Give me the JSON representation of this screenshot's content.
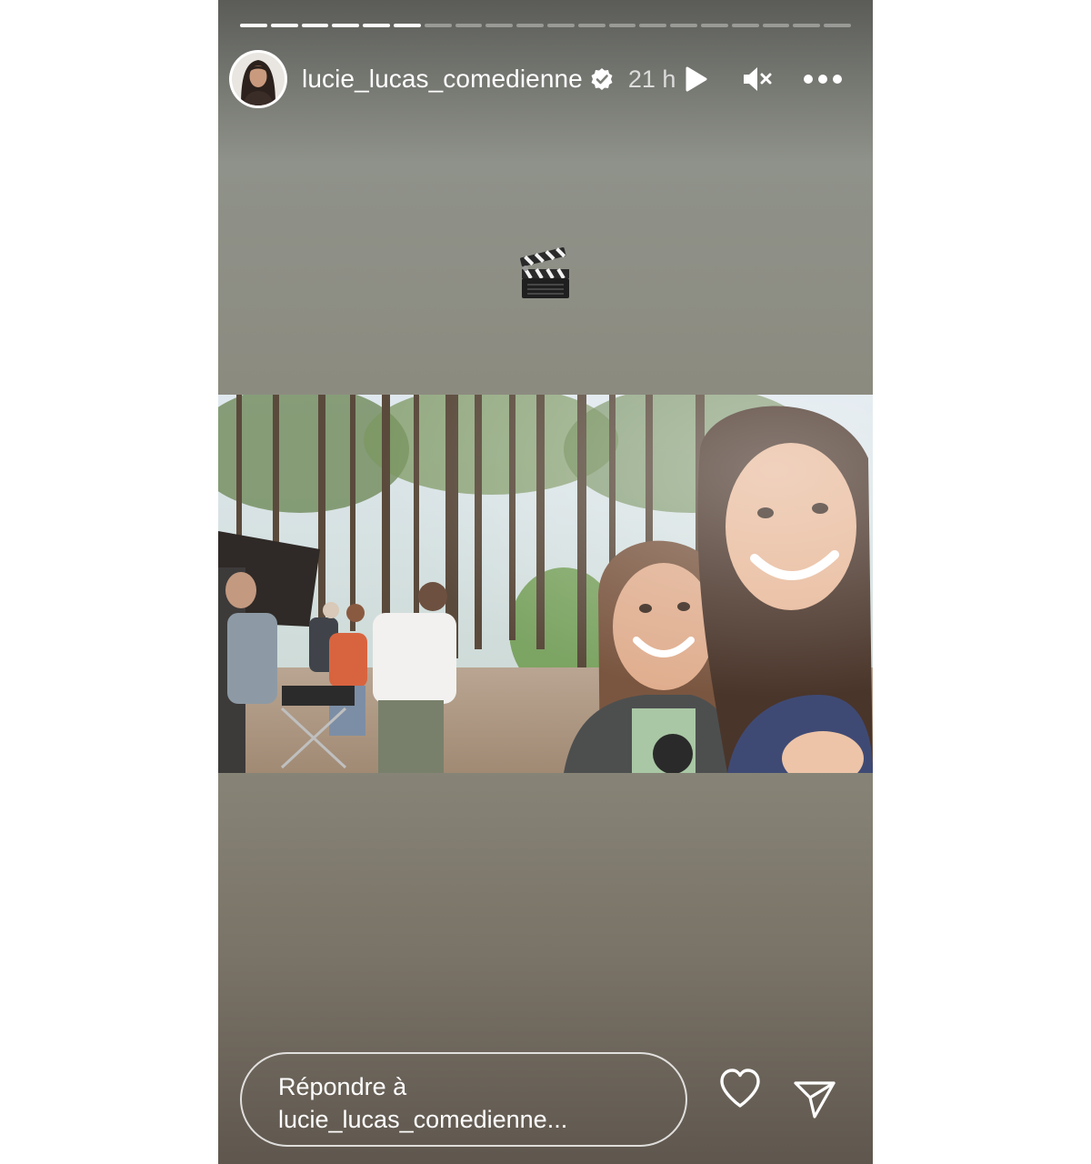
{
  "story": {
    "progress": {
      "total_segments": 20,
      "completed_segments": 6
    },
    "header": {
      "username": "lucie_lucas_comedienne",
      "verified": true,
      "timestamp": "21 h"
    },
    "sticker": {
      "emoji": "🎬"
    },
    "icons": {
      "play": "play-icon",
      "mute": "speaker-muted-icon",
      "more": "more-horizontal-icon",
      "verified": "verified-badge-icon",
      "like": "heart-outline-icon",
      "send": "paper-plane-icon"
    },
    "footer": {
      "reply_line1": "Répondre à",
      "reply_line2": "lucie_lucas_comedienne..."
    },
    "colors": {
      "verified_badge": "#ffffff",
      "text": "#ffffff"
    }
  }
}
